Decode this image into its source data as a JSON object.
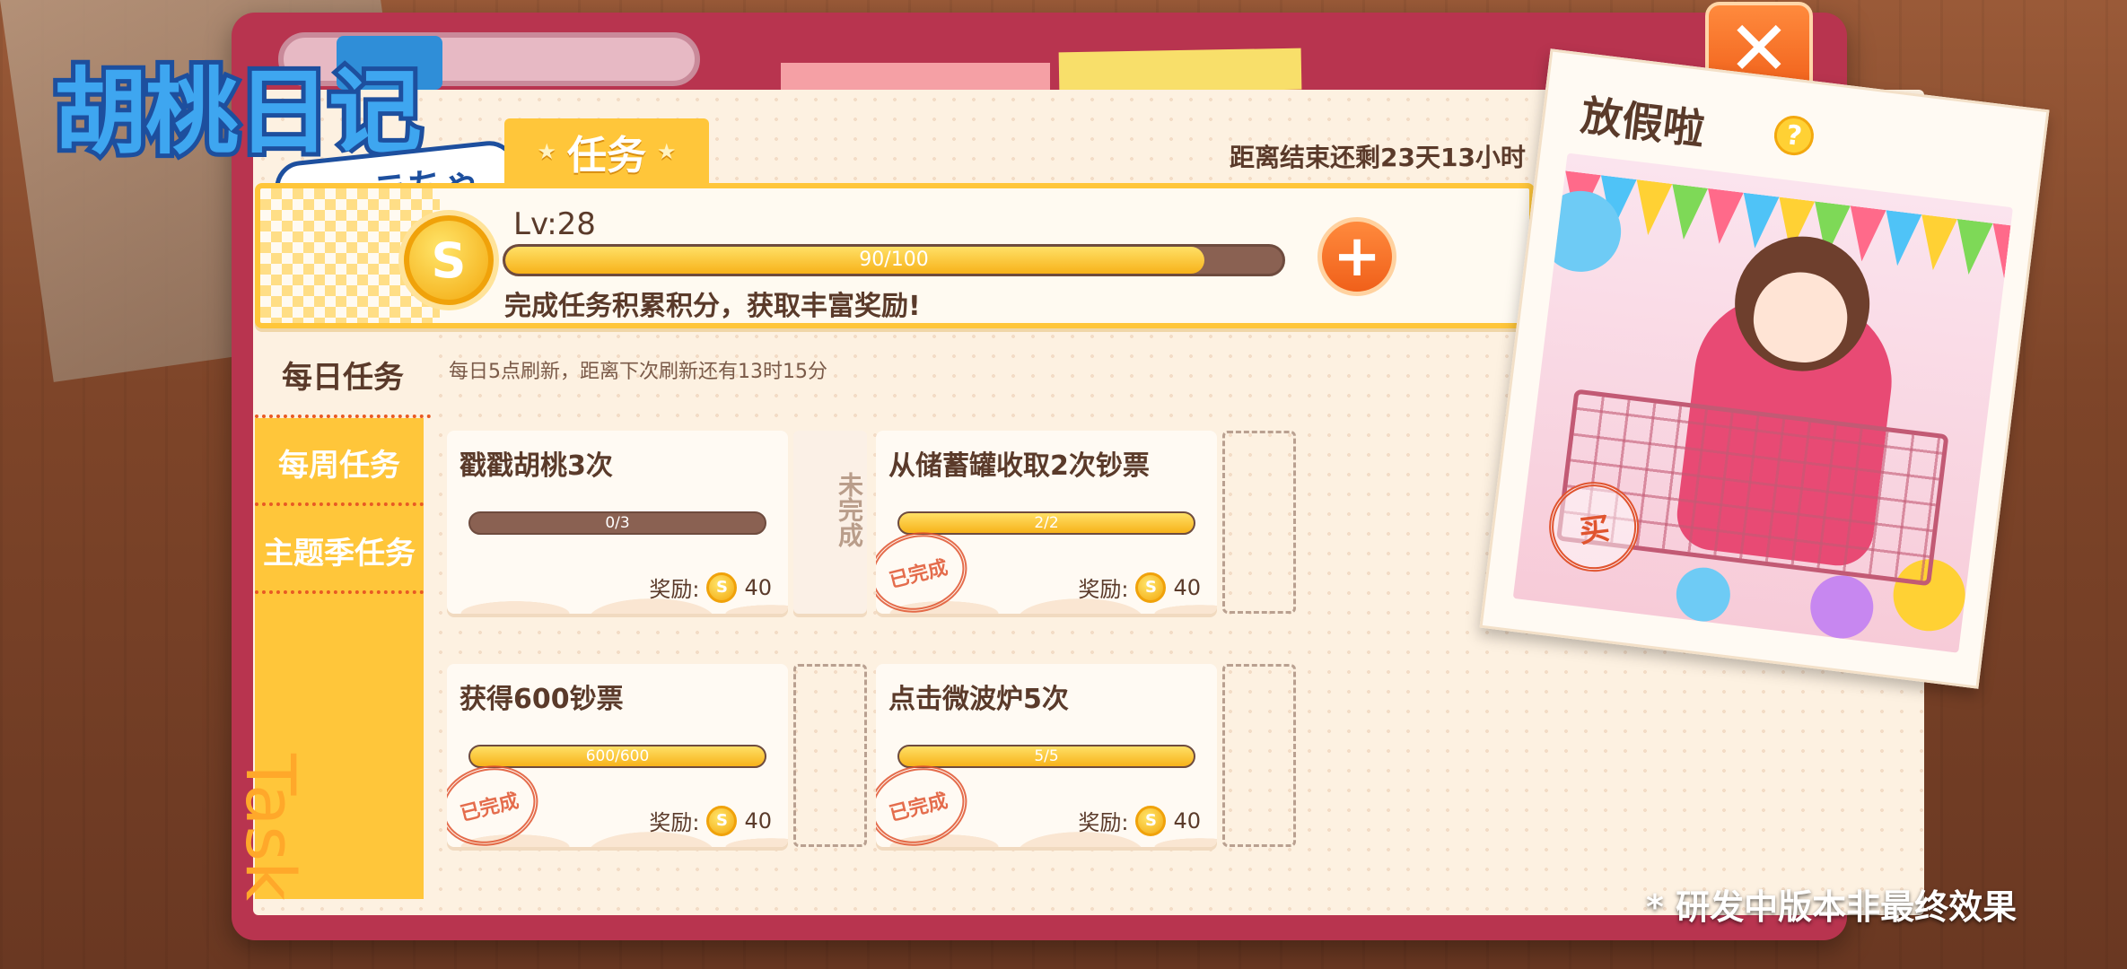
{
  "logo": {
    "title": "胡桃日记",
    "subtitle": "ンヘラちゃん"
  },
  "header": {
    "tab_label": "任务",
    "countdown": "距离结束还剩23天13小时",
    "close_icon": "close-icon"
  },
  "level": {
    "label": "Lv:28",
    "progress_text": "90/100",
    "progress": 0.9,
    "description": "完成任务积累积分，获取丰富奖励!",
    "coin_symbol": "S",
    "plus_symbol": "+"
  },
  "sidebar": {
    "items": [
      {
        "label": "每日任务",
        "active": true
      },
      {
        "label": "每周任务",
        "active": false
      },
      {
        "label": "主题季任务",
        "active": false
      }
    ],
    "watermark": "Task"
  },
  "main": {
    "refresh_note": "每日5点刷新，距离下次刷新还有13时15分",
    "reward_label": "奖励:",
    "stamp_text": "已完成",
    "tasks": [
      {
        "title": "戳戳胡桃3次",
        "progress_text": "0/3",
        "progress": 0.0,
        "reward": "40",
        "completed": false,
        "side_label": "未完成"
      },
      {
        "title": "从储蓄罐收取2次钞票",
        "progress_text": "2/2",
        "progress": 1.0,
        "reward": "40",
        "completed": true,
        "side_label": ""
      },
      {
        "title": "获得600钞票",
        "progress_text": "600/600",
        "progress": 1.0,
        "reward": "40",
        "completed": true,
        "side_label": ""
      },
      {
        "title": "点击微波炉5次",
        "progress_text": "5/5",
        "progress": 1.0,
        "reward": "40",
        "completed": true,
        "side_label": ""
      }
    ]
  },
  "event": {
    "title": "放假啦",
    "help_symbol": "?",
    "stamp_text": "买"
  },
  "disclaimer": "* 研发中版本非最终效果",
  "colors": {
    "accent_yellow": "#ffc63a",
    "accent_orange": "#f0601a",
    "binder": "#b8344f",
    "paper": "#fdf1e1",
    "text_brown": "#5a3a2a"
  }
}
